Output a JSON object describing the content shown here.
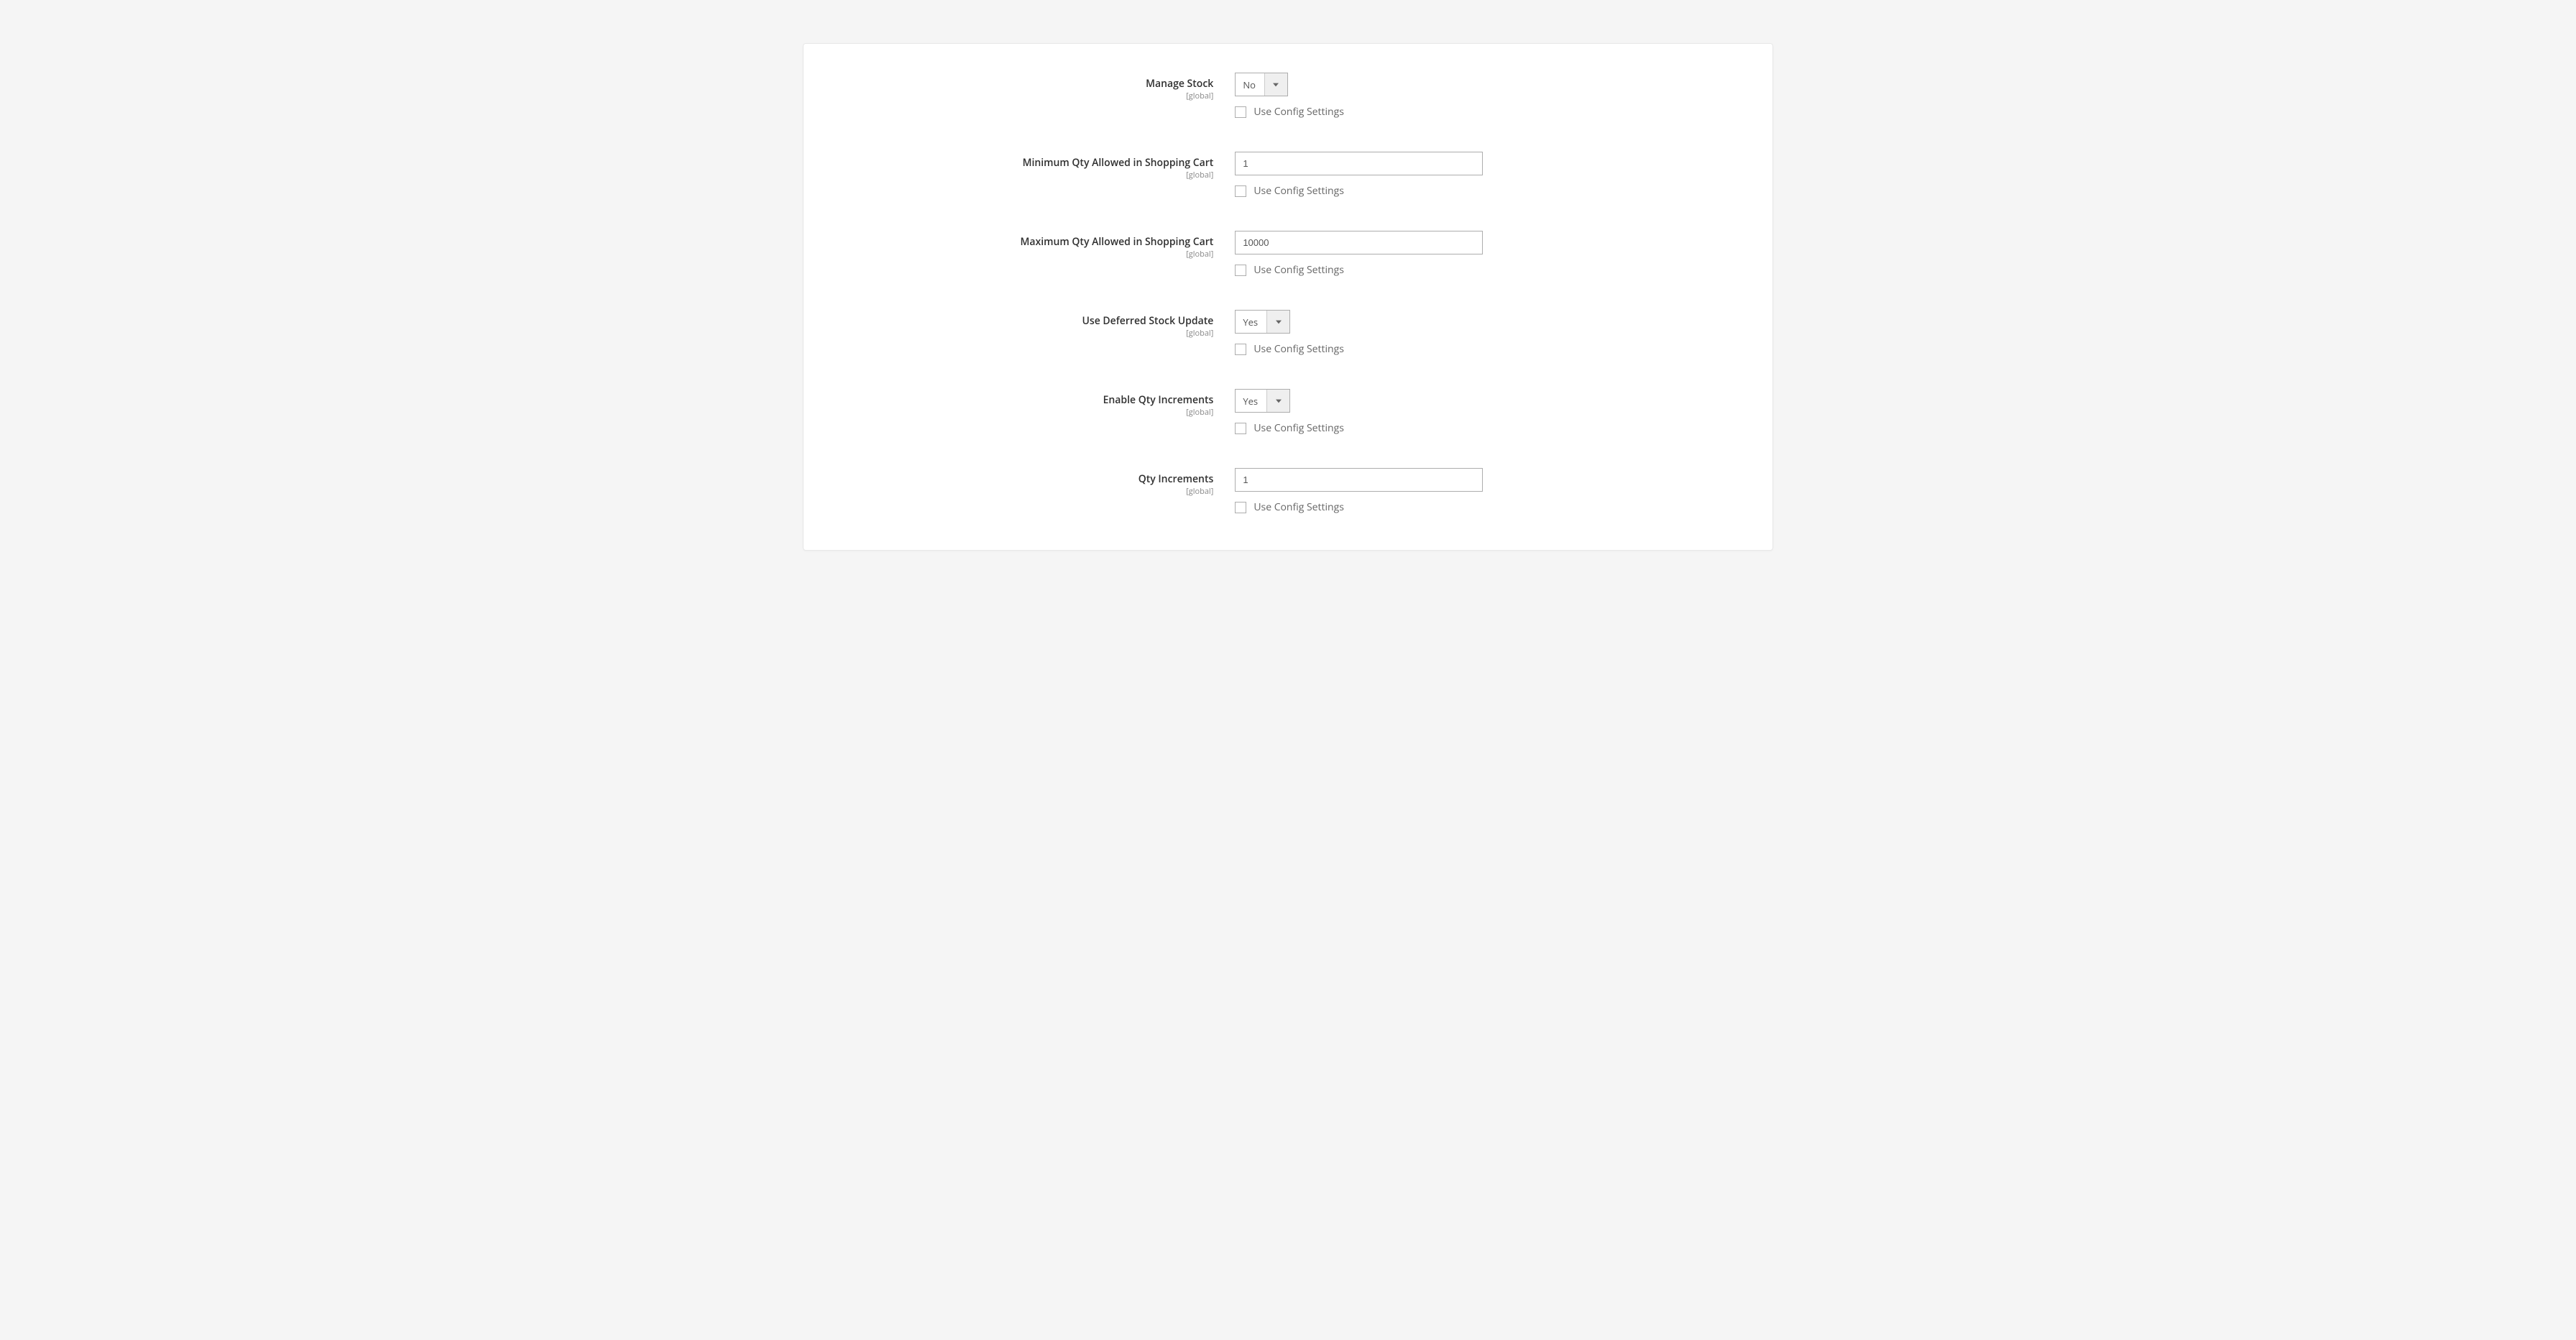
{
  "common": {
    "scope_label": "[global]",
    "use_config_label": "Use Config Settings"
  },
  "fields": {
    "manage_stock": {
      "label": "Manage Stock",
      "value": "No"
    },
    "min_qty": {
      "label": "Minimum Qty Allowed in Shopping Cart",
      "value": "1"
    },
    "max_qty": {
      "label": "Maximum Qty Allowed in Shopping Cart",
      "value": "10000"
    },
    "deferred_stock": {
      "label": "Use Deferred Stock Update",
      "value": "Yes"
    },
    "enable_qty_inc": {
      "label": "Enable Qty Increments",
      "value": "Yes"
    },
    "qty_inc": {
      "label": "Qty Increments",
      "value": "1"
    }
  }
}
